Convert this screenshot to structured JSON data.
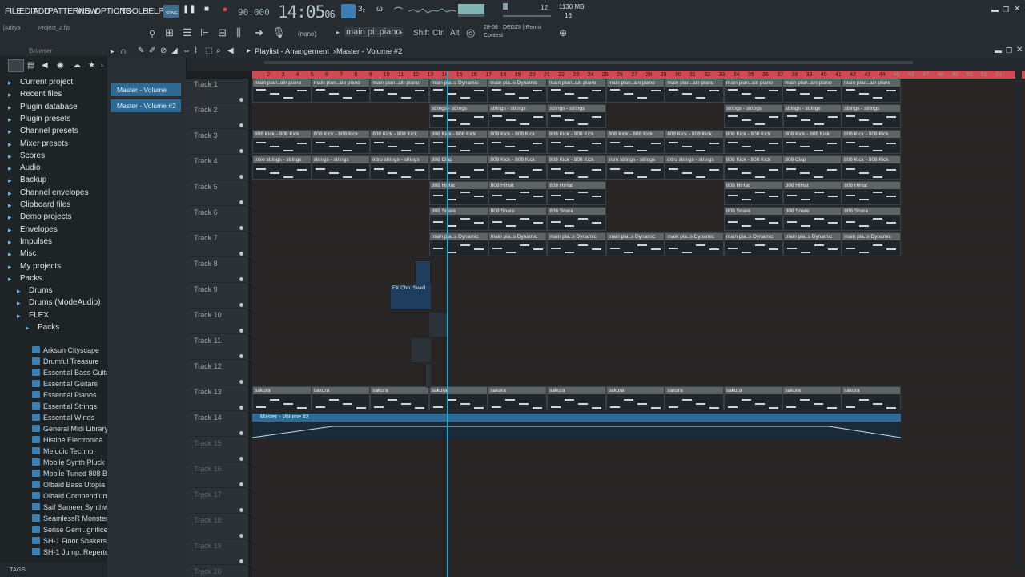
{
  "menu": [
    "FILE",
    "EDIT",
    "ADD",
    "PATTERNS",
    "VIEW",
    "OPTIONS",
    "TOOLS",
    "HELP"
  ],
  "transport": {
    "mode": "SONG",
    "tempo": "90.000",
    "time": "14:05",
    "time_sub": "06",
    "cpu_label": "1130 MB",
    "cpu_value": "16",
    "poly": "12"
  },
  "toolbar": {
    "user": "[Aditya",
    "project": "Project_2.flp",
    "preset": "(none)",
    "pattern": "main pi..piano",
    "shift": "Shift",
    "ctrl": "Ctrl",
    "alt": "Alt",
    "news_date": "28-08",
    "news_title": "DEDZII | Remix",
    "news_sub": "Contest"
  },
  "browser": {
    "title": "Browser",
    "items": [
      "Current project",
      "Recent files",
      "Plugin database",
      "Plugin presets",
      "Channel presets",
      "Mixer presets",
      "Scores",
      "Audio",
      "Backup",
      "Channel envelopes",
      "Clipboard files",
      "Demo projects",
      "Envelopes",
      "Impulses",
      "Misc",
      "My projects",
      "Packs",
      "Drums",
      "Drums (ModeAudio)",
      "FLEX",
      "Packs"
    ],
    "packs": [
      "Arksun Cityscape",
      "Drumful Treasure",
      "Essential Bass Guitars",
      "Essential Guitars",
      "Essential Pianos",
      "Essential Strings",
      "Essential Winds",
      "General Midi Library",
      "Histibe Electronica",
      "Melodic Techno",
      "Mobile Synth Pluck",
      "Mobile Tuned 808 Bass",
      "Olbaid Bass Utopia",
      "Olbaid Compendium",
      "Saif Sameer Synthwave",
      "SeamlessR Monsters",
      "Sense Gemi..gnificence",
      "SH-1 Floor Shakers",
      "SH-1 Jump..Repertoire"
    ],
    "tags": "TAGS"
  },
  "picker": [
    "Master - Volume",
    "Master - Volume #2"
  ],
  "playlist": {
    "breadcrumb": "Playlist - Arrangement",
    "pattern": "Master - Volume #2"
  },
  "ruler": [
    "2",
    "3",
    "4",
    "5",
    "6",
    "7",
    "8",
    "9",
    "10",
    "11",
    "12",
    "13",
    "14",
    "15",
    "16",
    "17",
    "18",
    "19",
    "20",
    "21",
    "22",
    "23",
    "24",
    "25",
    "26",
    "27",
    "28",
    "29",
    "30",
    "31",
    "32",
    "33",
    "34",
    "35",
    "36",
    "37",
    "38",
    "39",
    "40",
    "41",
    "42",
    "43",
    "44",
    "45",
    "46",
    "47",
    "48",
    "49",
    "50",
    "51",
    "52"
  ],
  "tracks": [
    "Track 1",
    "Track 2",
    "Track 3",
    "Track 4",
    "Track 5",
    "Track 6",
    "Track 7",
    "Track 8",
    "Track 9",
    "Track 10",
    "Track 11",
    "Track 12",
    "Track 13",
    "Track 14",
    "Track 15",
    "Track 16",
    "Track 17",
    "Track 18",
    "Track 19",
    "Track 20"
  ],
  "clips": {
    "t1": [
      "main pian..ain piano",
      "main pian..ain piano",
      "main pian..ain piano",
      "main pia..s Dynamic",
      "main pia..s Dynamic",
      "main pian..ain piano",
      "main pian..ain piano",
      "main pian..ain piano",
      "main pian..ain piano",
      "main pian..ain piano",
      "main pian..ain piano"
    ],
    "t2": [
      "strings - strings",
      "strings - strings",
      "strings - strings",
      "strings - strings",
      "strings - strings",
      "strings - strings"
    ],
    "t3": [
      "808 Kick - 808 Kick",
      "808 Kick - 808 Kick",
      "808 Kick - 808 Kick",
      "808 Kick - 808 Kick",
      "808 Kick - 808 Kick",
      "808 Kick - 808 Kick",
      "808 Kick - 808 Kick",
      "808 Kick - 808 Kick",
      "808 Kick - 808 Kick",
      "808 Kick - 808 Kick",
      "808 Kick - 808 Kick"
    ],
    "t4": [
      "intro strings - strings",
      "strings - strings",
      "intro strings - strings",
      "808 Clap",
      "808 Kick - 808 Kick",
      "808 Kick - 808 Kick",
      "intro strings - strings",
      "intro strings - strings",
      "808 Kick - 808 Kick",
      "808 Clap",
      "808 Kick - 808 Kick"
    ],
    "t5": [
      "808 HiHat",
      "808 HiHat",
      "808 HiHat",
      "808 HiHat",
      "808 HiHat",
      "808 HiHat"
    ],
    "t6": [
      "808 Snare",
      "808 Snare",
      "808 Snare",
      "808 Snare",
      "808 Snare",
      "808 Snare"
    ],
    "t7": [
      "main pia..s Dynamic",
      "main pia..s Dynamic",
      "main pia..s Dynamic",
      "main pia..s Dynamic",
      "main pia..s Dynamic",
      "main pia..s Dynamic",
      "main pia..s Dynamic",
      "main pia..s Dynamic"
    ],
    "t9": "FX Cho..Swell",
    "t13": [
      "sakura",
      "sakura",
      "sakura",
      "sakura",
      "sakura",
      "sakura",
      "sakura",
      "sakura",
      "sakura",
      "sakura",
      "sakura"
    ],
    "t14": "Master - Volume #2"
  },
  "colors": {
    "accent": "#2fa9c9",
    "ruler": "#d04a55",
    "clip": "#5d6468",
    "automation": "#2d6a96"
  }
}
